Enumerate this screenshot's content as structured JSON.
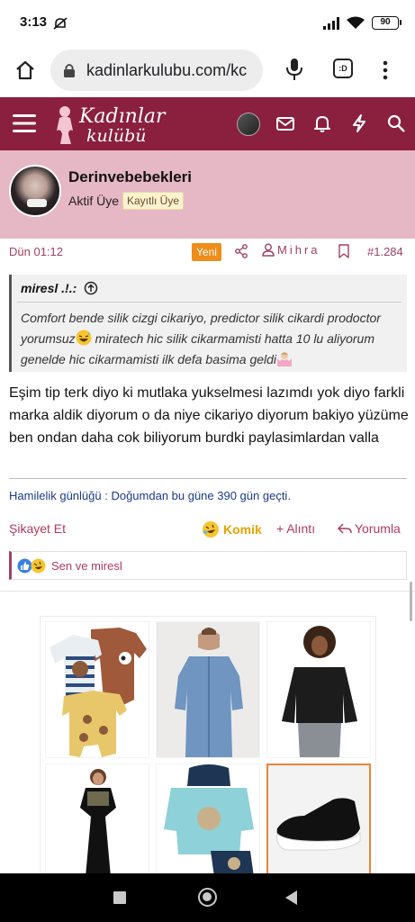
{
  "status_bar": {
    "time": "3:13",
    "battery": "90",
    "icons": [
      "do-not-disturb-icon",
      "signal-icon",
      "wifi-icon",
      "battery-icon"
    ]
  },
  "browser": {
    "url": "kadinlarkulubu.com/kc",
    "tab_count": ":D",
    "icons": [
      "home-icon",
      "lock-icon",
      "mic-icon",
      "tabs-icon",
      "more-icon"
    ]
  },
  "site_header": {
    "logo_line1": "Kadınlar",
    "logo_line2": "kulübü",
    "icons": [
      "menu-icon",
      "avatar",
      "mail-icon",
      "bell-icon",
      "bolt-icon",
      "search-icon"
    ],
    "color": "#8a1f3e"
  },
  "post": {
    "username": "Derinvebebekleri",
    "role": "Aktif Üye",
    "badge": "Kayıtlı Üye",
    "date": "Dün 01:12",
    "new_label": "Yeni",
    "author": "Mihra",
    "post_number": "#1.284",
    "quote": {
      "author": "miresl .!.:",
      "text_part1": "Comfort bende silik cizgi cikariyo, predictor silik cikardi prodoctor yorumsuz",
      "text_part2": " miratech hic silik cikarmamisti hatta 10 lu aliyorum genelde hic cikarmamisti ilk defa basima geldi"
    },
    "message": "Eşim tip terk diyo ki mutlaka yukselmesi lazımdı yok diyo farkli marka aldik diyorum o da niye cikariyo diyorum bakiyo yüzüme ben ondan daha cok biliyorum burdki paylasimlardan valla",
    "signature": "Hamilelik günlüğü : Doğumdan bu güne 390 gün geçti.",
    "actions": {
      "report": "Şikayet Et",
      "funny": "Komik",
      "quote": "Alıntı",
      "reply": "Yorumla"
    },
    "reactions_text": "Sen ve miresl",
    "accent_color": "#b03a5e"
  },
  "ads": {
    "items": [
      "baby-rompers",
      "denim-dress",
      "black-blouse",
      "black-maxi-dress",
      "kids-hoodie-set",
      "black-sneaker"
    ]
  },
  "nav_bar": {
    "icons": [
      "recents-square-icon",
      "home-circle-icon",
      "back-triangle-icon"
    ]
  }
}
